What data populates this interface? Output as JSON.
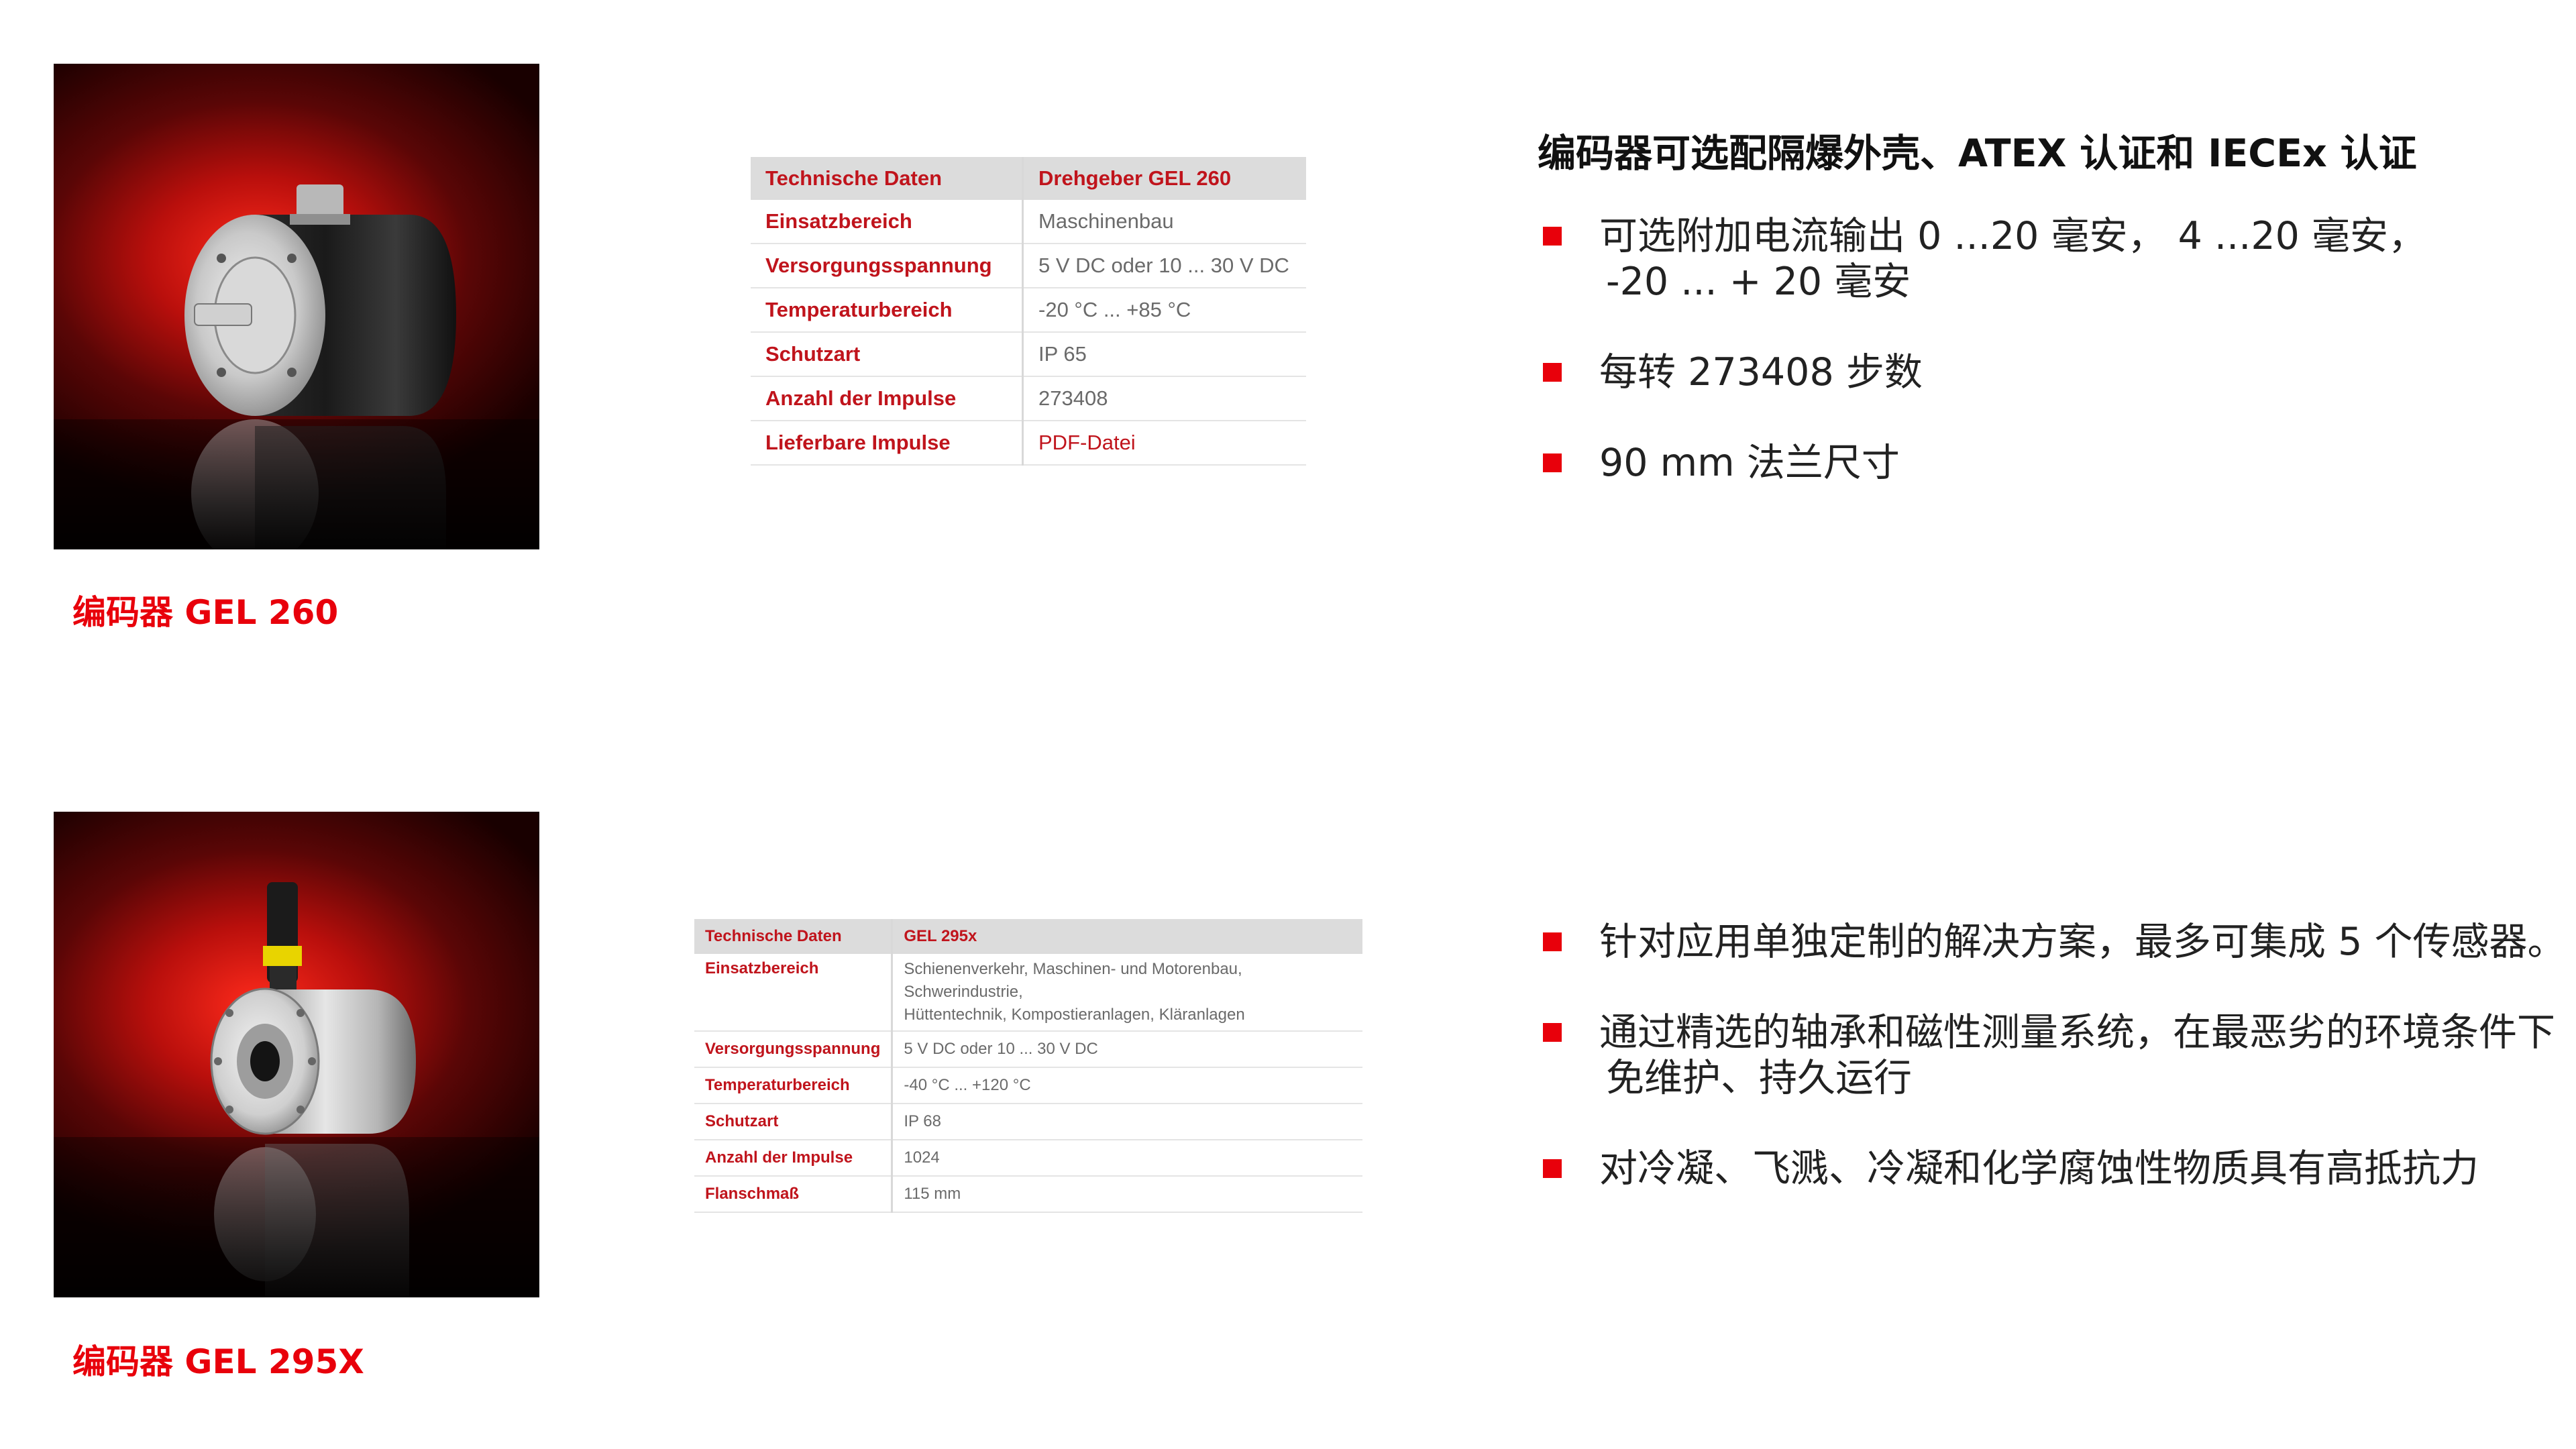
{
  "products": [
    {
      "caption": "编码器 GEL 260",
      "photo_icon": "rotary-encoder-gel260",
      "spec_table": {
        "header": [
          "Technische Daten",
          "Drehgeber GEL 260"
        ],
        "rows": [
          [
            "Einsatzbereich",
            "Maschinenbau"
          ],
          [
            "Versorgungsspannung",
            "5 V DC oder 10 ... 30 V DC"
          ],
          [
            "Temperaturbereich",
            "-20 °C ... +85 °C"
          ],
          [
            "Schutzart",
            "IP 65"
          ],
          [
            "Anzahl der Impulse",
            "273408"
          ],
          [
            "Lieferbare Impulse",
            "PDF-Datei"
          ]
        ]
      },
      "heading": "编码器可选配隔爆外壳、ATEX 认证和 IECEx 认证",
      "bullets": [
        {
          "text": "可选附加电流输出 0 ...20 毫安，  4 ...20 毫安，",
          "cont": "-20 ... + 20 毫安"
        },
        {
          "text": "每转 273408 步数"
        },
        {
          "text": "90 mm 法兰尺寸"
        }
      ]
    },
    {
      "caption": "编码器 GEL 295X",
      "photo_icon": "hollow-shaft-encoder-gel295x",
      "spec_table": {
        "header": [
          "Technische Daten",
          "GEL 295x"
        ],
        "rows": [
          [
            "Einsatzbereich",
            "Schienenverkehr, Maschinen- und Motorenbau, Schwerindustrie,",
            "Hüttentechnik, Kompostieranlagen, Kläranlagen"
          ],
          [
            "Versorgungsspannung",
            "5 V DC oder 10 ... 30 V DC"
          ],
          [
            "Temperaturbereich",
            "-40 °C ... +120 °C"
          ],
          [
            "Schutzart",
            "IP 68"
          ],
          [
            "Anzahl der Impulse",
            "1024"
          ],
          [
            "Flanschmaß",
            "115 mm"
          ]
        ]
      },
      "bullets": [
        {
          "text": "针对应用单独定制的解决方案，最多可集成 5 个传感器。"
        },
        {
          "text": "通过精选的轴承和磁性测量系统，在最恶劣的环境条件下",
          "cont": "免维护、持久运行"
        },
        {
          "text": "对冷凝、飞溅、冷凝和化学腐蚀性物质具有高抵抗力"
        }
      ]
    }
  ],
  "colors": {
    "accent_red": "#e8000b",
    "table_key_red": "#c0141c",
    "table_header_bg": "#dcdcdc"
  }
}
